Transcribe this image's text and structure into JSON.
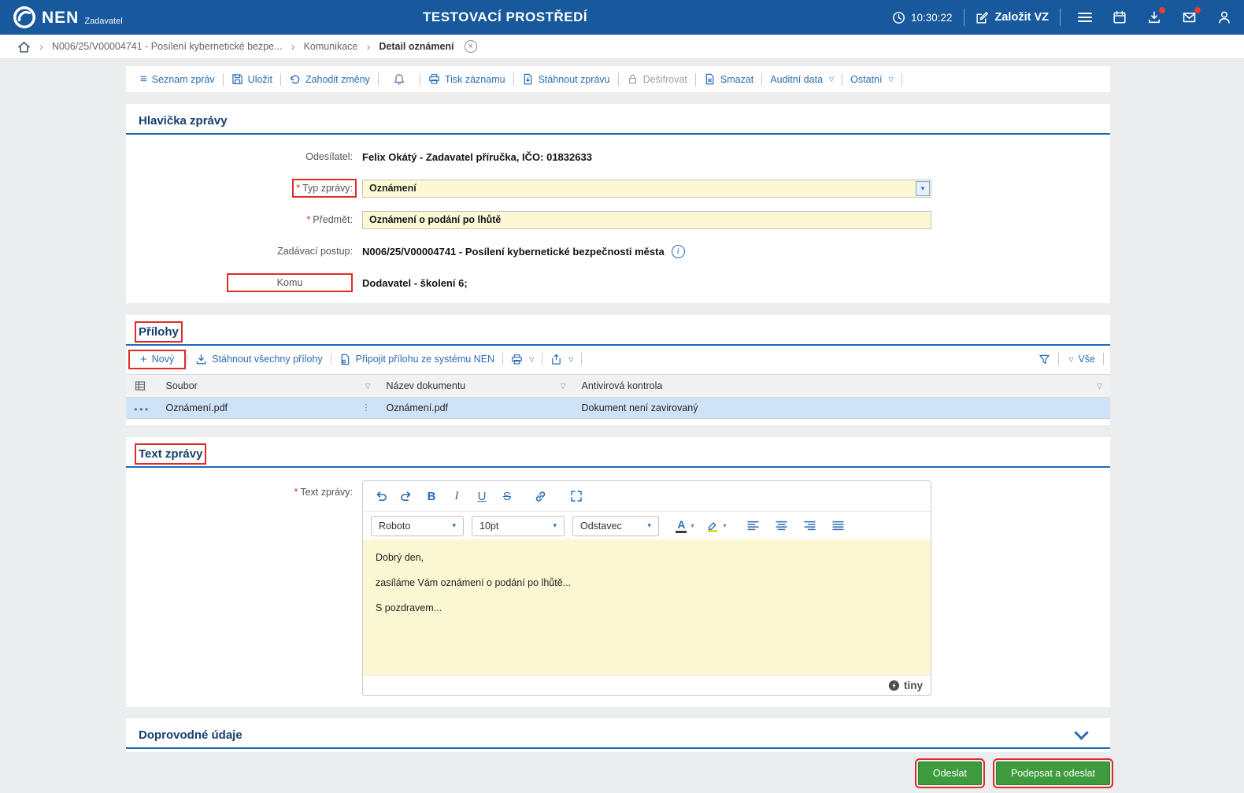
{
  "colors": {
    "topbar_bg": "#17599c",
    "accent_blue": "#2a6cb5",
    "section_title": "#173f70",
    "field_yellow": "#fcf8d3",
    "selected_row": "#cfe3f8",
    "green_button": "#3d9b3d",
    "annotation_red": "#e02b2b",
    "required_red": "#d03030",
    "badge_red": "#e8412f"
  },
  "icons": {
    "caret_down_small": "▾",
    "caret_down_open": "▽",
    "list": "≡",
    "plus": "+",
    "row_dots": "●●●",
    "grip": "⋮",
    "close": "×",
    "crumb_sep": "›",
    "required_mark": "*",
    "info": "i"
  },
  "topbar": {
    "brand": "NEN",
    "brand_sub": "Zadavatel",
    "env_title": "TESTOVACÍ PROSTŘEDÍ",
    "time": "10:30:22",
    "create_vz": "Založit VZ"
  },
  "breadcrumb": {
    "items": [
      {
        "label": "N006/25/V00004741 - Posílení kybernetické bezpe..."
      },
      {
        "label": "Komunikace"
      },
      {
        "label": "Detail oznámení"
      }
    ]
  },
  "toolbar": {
    "seznam": "Seznam zpráv",
    "ulozit": "Uložit",
    "zahodit": "Zahodit změny",
    "tisk": "Tisk záznamu",
    "stahnout": "Stáhnout zprávu",
    "desifrovat": "Dešifrovat",
    "smazat": "Smazat",
    "auditni": "Auditní data",
    "ostatni": "Ostatní"
  },
  "message_header": {
    "section_title": "Hlavička zprávy",
    "sender_label": "Odesílatel:",
    "sender_value": "Felix Okátý - Zadavatel příručka, IČO: 01832633",
    "type_label": "Typ zprávy:",
    "type_value": "Oznámení",
    "subject_label": "Předmět:",
    "subject_value": "Oznámení o podání po lhůtě",
    "procedure_label": "Zadávací postup:",
    "procedure_value": "N006/25/V00004741 - Posílení kybernetické bezpečnosti města",
    "to_label": "Komu",
    "to_value": "Dodavatel - školení 6;"
  },
  "attachments": {
    "section_title": "Přílohy",
    "new": "Nový",
    "download_all": "Stáhnout všechny přílohy",
    "attach_from_nen": "Připojit přílohu ze systému NEN",
    "filter_all": "Vše",
    "columns": [
      "Soubor",
      "Název dokumentu",
      "Antivirová kontrola"
    ],
    "rows": [
      {
        "file": "Oznámení.pdf",
        "document_name": "Oznámení.pdf",
        "antivirus": "Dokument není zavirovaný"
      }
    ]
  },
  "message_text": {
    "section_title": "Text zprávy",
    "field_label": "Text zprávy:",
    "editor": {
      "font_name": "Roboto",
      "font_size": "10pt",
      "block_format": "Odstavec",
      "paragraphs": [
        "Dobrý den,",
        "zasíláme Vám oznámení o podání po lhůtě...",
        "S pozdravem..."
      ],
      "brand": "tiny"
    }
  },
  "accompanying_data": {
    "section_title": "Doprovodné údaje"
  },
  "actions": {
    "send": "Odeslat",
    "sign_and_send": "Podepsat a odeslat"
  }
}
